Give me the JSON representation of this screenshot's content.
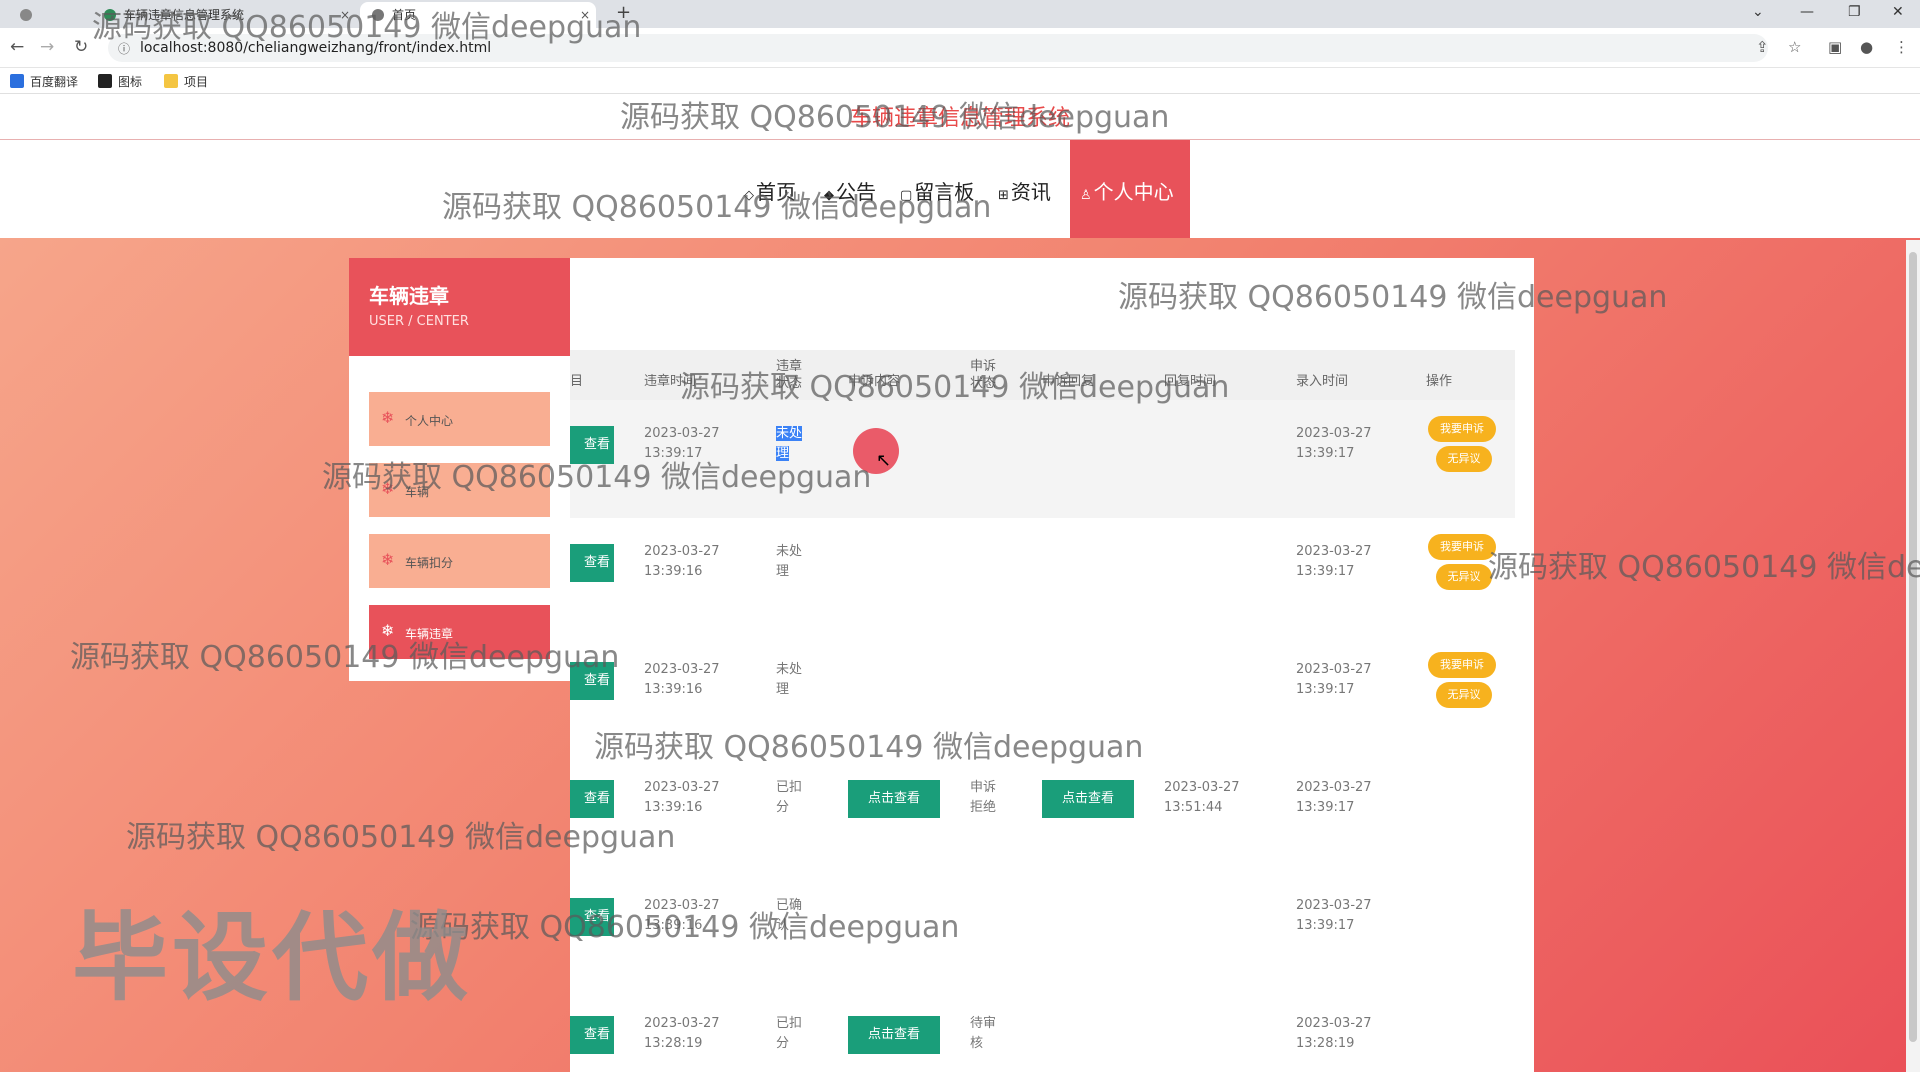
{
  "browser": {
    "tabs": [
      {
        "label": "",
        "active": false
      },
      {
        "label": "车辆违章信息管理系统",
        "active": false
      },
      {
        "label": "首页",
        "active": true
      }
    ],
    "new_tab": "+",
    "url": "localhost:8080/cheliangweizhang/front/index.html",
    "bookmarks": [
      "百度翻译",
      "图标",
      "项目"
    ]
  },
  "site": {
    "title": "车辆违章信息管理系统",
    "nav": [
      "首页",
      "公告",
      "留言板",
      "资讯",
      "个人中心"
    ],
    "active_nav": "个人中心"
  },
  "sidebar": {
    "title": "车辆违章",
    "subtitle": "USER / CENTER",
    "items": [
      "个人中心",
      "车辆",
      "车辆扣分",
      "车辆违章"
    ],
    "active_item": "车辆违章"
  },
  "table": {
    "headers": [
      "目",
      "违章时间",
      "违章\n状态",
      "申诉内容",
      "申诉\n状态",
      "申诉回复",
      "回复时间",
      "录入时间",
      "操作"
    ],
    "rows": [
      {
        "view": "查看",
        "time1": "2023-03-27",
        "time2": "13:39:17",
        "status1": "未处",
        "status2": "理",
        "appeal_btn": "",
        "appeal_status1": "",
        "appeal_status2": "",
        "reply_btn": "",
        "reply_time1": "",
        "reply_time2": "",
        "entry1": "2023-03-27",
        "entry2": "13:39:17",
        "op1": "我要申诉",
        "op2": "无异议"
      },
      {
        "view": "查看",
        "time1": "2023-03-27",
        "time2": "13:39:16",
        "status1": "未处",
        "status2": "理",
        "appeal_btn": "",
        "appeal_status1": "",
        "appeal_status2": "",
        "reply_btn": "",
        "reply_time1": "",
        "reply_time2": "",
        "entry1": "2023-03-27",
        "entry2": "13:39:17",
        "op1": "我要申诉",
        "op2": "无异议"
      },
      {
        "view": "查看",
        "time1": "2023-03-27",
        "time2": "13:39:16",
        "status1": "未处",
        "status2": "理",
        "appeal_btn": "",
        "appeal_status1": "",
        "appeal_status2": "",
        "reply_btn": "",
        "reply_time1": "",
        "reply_time2": "",
        "entry1": "2023-03-27",
        "entry2": "13:39:17",
        "op1": "我要申诉",
        "op2": "无异议"
      },
      {
        "view": "查看",
        "time1": "2023-03-27",
        "time2": "13:39:16",
        "status1": "已扣",
        "status2": "分",
        "appeal_btn": "点击查看",
        "appeal_status1": "申诉",
        "appeal_status2": "拒绝",
        "reply_btn": "点击查看",
        "reply_time1": "2023-03-27",
        "reply_time2": "13:51:44",
        "entry1": "2023-03-27",
        "entry2": "13:39:17",
        "op1": "",
        "op2": ""
      },
      {
        "view": "查看",
        "time1": "2023-03-27",
        "time2": "13:39:16",
        "status1": "已确",
        "status2": "认",
        "appeal_btn": "",
        "appeal_status1": "",
        "appeal_status2": "",
        "reply_btn": "",
        "reply_time1": "",
        "reply_time2": "",
        "entry1": "2023-03-27",
        "entry2": "13:39:17",
        "op1": "",
        "op2": ""
      },
      {
        "view": "查看",
        "time1": "2023-03-27",
        "time2": "13:28:19",
        "status1": "已扣",
        "status2": "分",
        "appeal_btn": "点击查看",
        "appeal_status1": "待审",
        "appeal_status2": "核",
        "reply_btn": "",
        "reply_time1": "",
        "reply_time2": "",
        "entry1": "2023-03-27",
        "entry2": "13:28:19",
        "op1": "",
        "op2": ""
      }
    ]
  },
  "watermarks": {
    "text": "源码获取 QQ86050149 微信deepguan",
    "big": "毕设代做"
  },
  "colors": {
    "primary_red": "#e8525a",
    "teal_button": "#1a9e7a",
    "yellow_button": "#f7b21e",
    "sidebar_item": "#f9ae92"
  }
}
